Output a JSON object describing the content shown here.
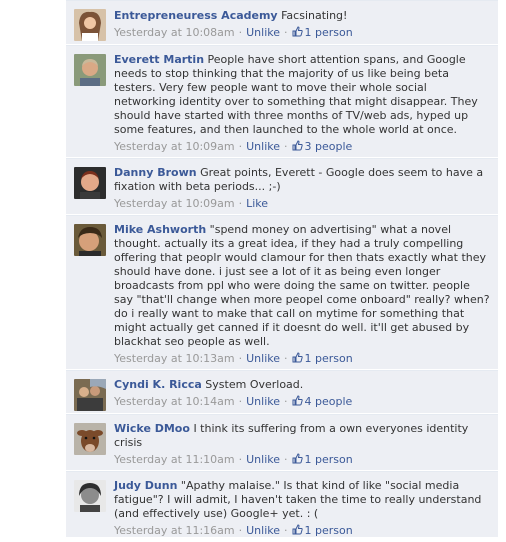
{
  "comments": [
    {
      "author": "Entrepreneuress Academy",
      "text": "Facsinating!",
      "time": "Yesterday at 10:08am",
      "action": "Unlike",
      "likes": "1 person"
    },
    {
      "author": "Everett Martin",
      "text": "People have short attention spans, and Google needs to stop thinking that the majority of us like being beta testers. Very few people want to move their whole social networking identity over to something that might disappear. They should have started with three months of TV/web ads, hyped up some features, and then launched to the whole world at once.",
      "time": "Yesterday at 10:09am",
      "action": "Unlike",
      "likes": "3 people"
    },
    {
      "author": "Danny Brown",
      "text": "Great points, Everett - Google does seem to have a fixation with beta periods... ;-)",
      "time": "Yesterday at 10:09am",
      "action": "Like",
      "likes": ""
    },
    {
      "author": "Mike Ashworth",
      "text": "\"spend money on advertising\" what a novel thought. actually its a great idea, if they had a truly compelling offering that peoplr would clamour for then thats exactly what they should have done. i just see a lot of it as being even longer broadcasts from ppl who were doing the same on twitter. people say \"that'll change when more peopel come onboard\" really? when? do i really want to make that call on mytime for something that might actually get canned if it doesnt do well. it'll get abused by blackhat seo people as well.",
      "time": "Yesterday at 10:13am",
      "action": "Unlike",
      "likes": "1 person"
    },
    {
      "author": "Cyndi K. Ricca",
      "text": "System Overload.",
      "time": "Yesterday at 10:14am",
      "action": "Unlike",
      "likes": "4 people"
    },
    {
      "author": "Wicke DMoo",
      "text": "I think its suffering from a own everyones identity crisis",
      "time": "Yesterday at 11:10am",
      "action": "Unlike",
      "likes": "1 person"
    },
    {
      "author": "Judy Dunn",
      "text": "\"Apathy malaise.\" Is that kind of like \"social media fatigue\"? I will admit, I haven't taken the time to really understand (and effectively use) Google+ yet. : (",
      "time": "Yesterday at 11:16am",
      "action": "Unlike",
      "likes": "1 person"
    }
  ],
  "colors": {
    "link": "#3b5998",
    "meta": "#999999",
    "comment_bg": "#edeff4",
    "text": "#333333"
  },
  "icons": {
    "like": "thumbs-up-icon"
  }
}
